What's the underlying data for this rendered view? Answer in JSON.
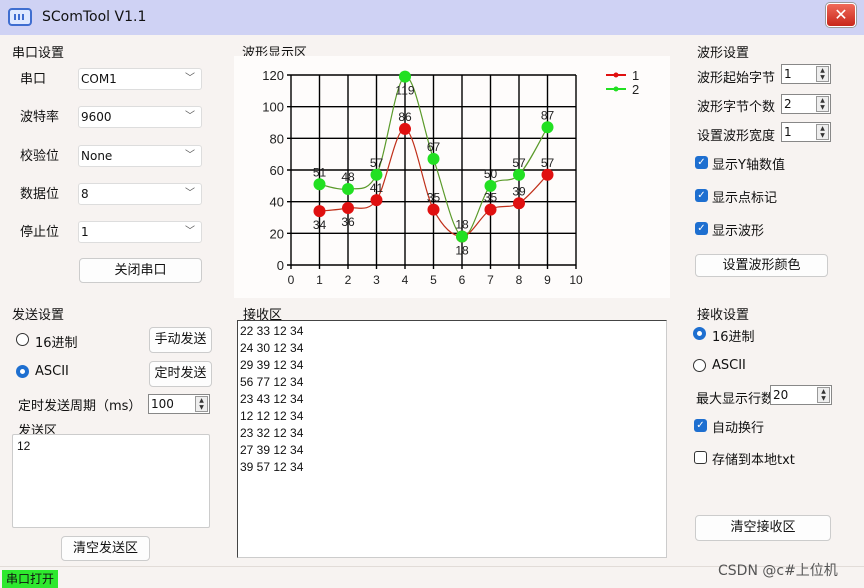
{
  "window": {
    "title": "SComTool V1.1",
    "close_label": "✕"
  },
  "serial_settings": {
    "title": "串口设置",
    "fields": [
      {
        "label": "串口",
        "value": "COM1"
      },
      {
        "label": "波特率",
        "value": "9600"
      },
      {
        "label": "校验位",
        "value": "None"
      },
      {
        "label": "数据位",
        "value": "8"
      },
      {
        "label": "停止位",
        "value": "1"
      }
    ],
    "toggle_button": "关闭串口"
  },
  "waveform_area": {
    "title": "波形显示区"
  },
  "waveform_settings": {
    "title": "波形设置",
    "start_byte_label": "波形起始字节",
    "start_byte_value": "1",
    "byte_count_label": "波形字节个数",
    "byte_count_value": "2",
    "width_label": "设置波形宽度",
    "width_value": "1",
    "show_y_values": {
      "label": "显示Y轴数值",
      "checked": true
    },
    "show_markers": {
      "label": "显示点标记",
      "checked": true
    },
    "show_wave": {
      "label": "显示波形",
      "checked": true
    },
    "color_button": "设置波形颜色"
  },
  "send_settings": {
    "title": "发送设置",
    "hex_label": "16进制",
    "ascii_label": "ASCII",
    "selected": "ASCII",
    "manual_send": "手动发送",
    "timed_send": "定时发送",
    "period_label": "定时发送周期（ms）",
    "period_value": "100",
    "send_area_label": "发送区",
    "send_area_value": "12",
    "clear_button": "清空发送区"
  },
  "receive_area": {
    "title": "接收区",
    "lines": [
      "22 33 12 34",
      "24 30 12 34",
      "29 39 12 34",
      "56 77 12 34",
      "23 43 12 34",
      "12 12 12 34",
      "23 32 12 34",
      "27 39 12 34",
      "39 57 12 34"
    ]
  },
  "receive_settings": {
    "title": "接收设置",
    "hex_label": "16进制",
    "ascii_label": "ASCII",
    "selected": "16进制",
    "max_lines_label": "最大显示行数",
    "max_lines_value": "20",
    "auto_wrap": {
      "label": "自动换行",
      "checked": true
    },
    "save_txt": {
      "label": "存储到本地txt",
      "checked": false
    },
    "clear_button": "清空接收区"
  },
  "status_bar": {
    "text": "串口打开",
    "color": "#2ee82e"
  },
  "watermark": "CSDN @c#上位机",
  "chart_data": {
    "type": "line",
    "title": "",
    "xlabel": "",
    "ylabel": "",
    "x": [
      1,
      2,
      3,
      4,
      5,
      6,
      7,
      8,
      9
    ],
    "xlim": [
      0,
      10
    ],
    "ylim": [
      0,
      120
    ],
    "xticks": [
      0,
      1,
      2,
      3,
      4,
      5,
      6,
      7,
      8,
      9,
      10
    ],
    "yticks": [
      0,
      20,
      40,
      60,
      80,
      100,
      120
    ],
    "grid": true,
    "legend_position": "top-right",
    "series": [
      {
        "name": "1",
        "color": "#e01010",
        "values": [
          34,
          36,
          41,
          86,
          35,
          18,
          35,
          39,
          57
        ],
        "labels_position": [
          "below",
          "below",
          "above",
          "above",
          "above",
          "below",
          "above",
          "above",
          "above"
        ]
      },
      {
        "name": "2",
        "color": "#22e022",
        "values": [
          51,
          48,
          57,
          119,
          67,
          18,
          50,
          57,
          87
        ],
        "labels_position": [
          "above",
          "above",
          "above",
          "below",
          "above",
          "above",
          "above",
          "above",
          "above"
        ]
      }
    ]
  }
}
